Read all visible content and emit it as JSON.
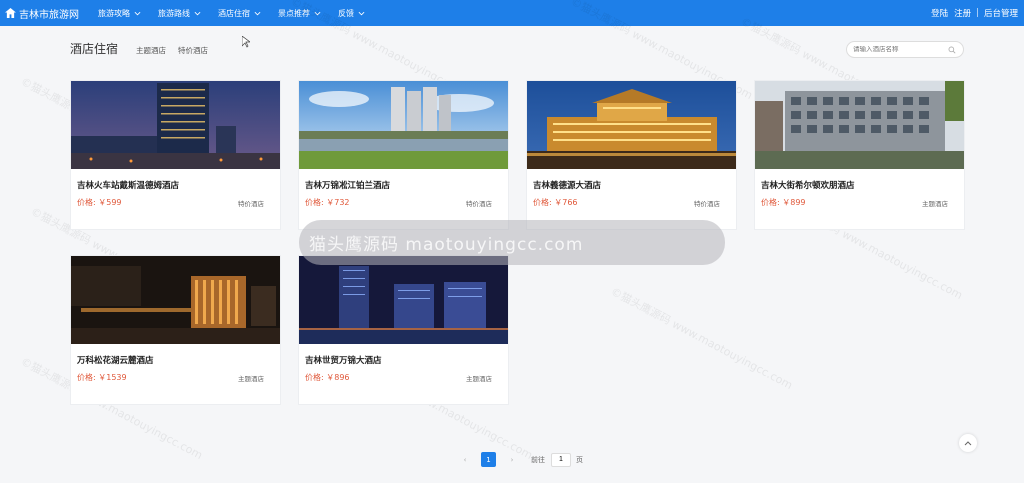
{
  "brand": {
    "title": "吉林市旅游网"
  },
  "nav": [
    {
      "label": "旅游攻略"
    },
    {
      "label": "旅游路线"
    },
    {
      "label": "酒店住宿"
    },
    {
      "label": "景点推荐"
    },
    {
      "label": "反馈"
    }
  ],
  "auth": {
    "login": "登陆",
    "register": "注册",
    "admin": "后台管理",
    "sep": "|"
  },
  "section": {
    "title": "酒店住宿",
    "tabs": [
      "主题酒店",
      "特价酒店"
    ]
  },
  "search": {
    "placeholder": "请输入酒店名称"
  },
  "hotels": [
    {
      "name": "吉林火车站戴斯温德姆酒店",
      "price": "价格: ￥599",
      "type": "特价酒店",
      "image": "night-city-hotel"
    },
    {
      "name": "吉林万锦凇江铂兰酒店",
      "price": "价格: ￥732",
      "type": "特价酒店",
      "image": "riverside-towers"
    },
    {
      "name": "吉林義德源大酒店",
      "price": "价格: ￥766",
      "type": "特价酒店",
      "image": "lit-palace-hotel"
    },
    {
      "name": "吉林大街希尔顿欢朋酒店",
      "price": "价格: ￥899",
      "type": "主题酒店",
      "image": "hotel-facade"
    },
    {
      "name": "万科松花湖云麓酒店",
      "price": "价格: ￥1539",
      "type": "主题酒店",
      "image": "resort-night"
    },
    {
      "name": "吉林世贸万锦大酒店",
      "price": "价格: ￥896",
      "type": "主题酒店",
      "image": "skyline-night"
    }
  ],
  "watermark": {
    "banner": "猫头鹰源码 maotouyingcc.com",
    "text": "©猫头鹰源码 www.maotouyingcc.com"
  },
  "pager": {
    "prev": "‹",
    "current": "1",
    "next": "›",
    "goto_label": "前往",
    "goto_value": "1",
    "unit": "页"
  },
  "colors": {
    "primary": "#1e7fe8",
    "price": "#e0593b",
    "bg": "#f5f6f8"
  }
}
